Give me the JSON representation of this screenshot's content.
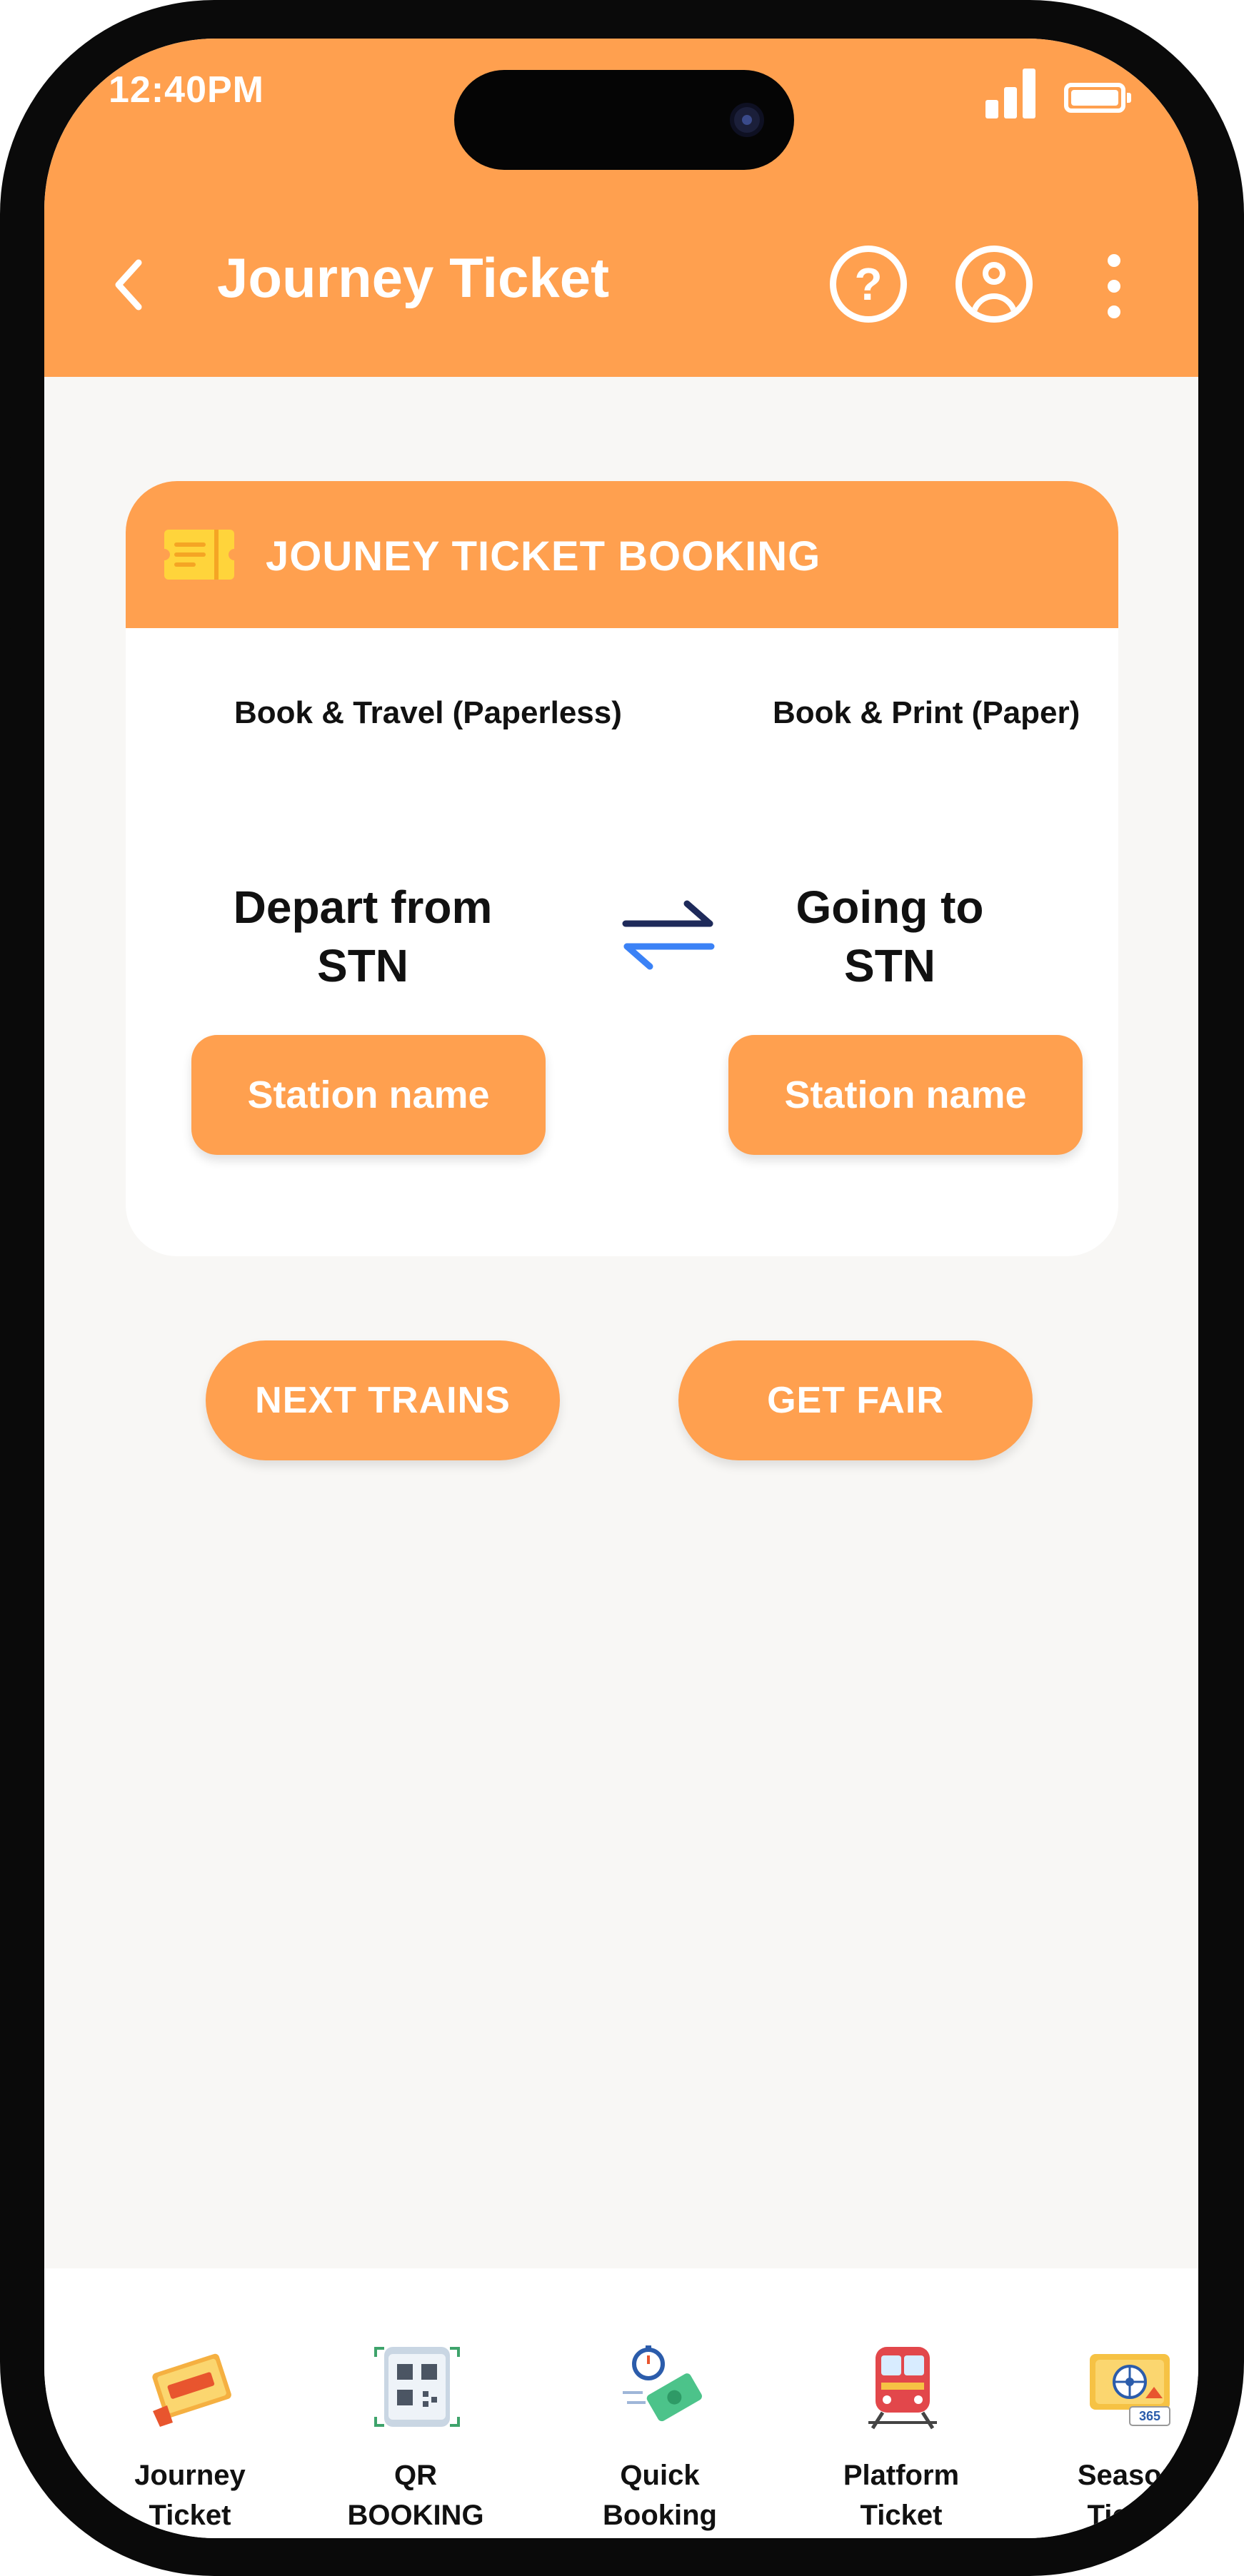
{
  "status_bar": {
    "time": "12:40PM"
  },
  "header": {
    "title": "Journey Ticket",
    "help_symbol": "?"
  },
  "card": {
    "title": "JOUNEY TICKET BOOKING",
    "tabs": [
      {
        "label": "Book & Travel (Paperless)"
      },
      {
        "label": "Book & Print (Paper)"
      }
    ],
    "from": {
      "line1": "Depart from",
      "line2": "STN",
      "button": "Station name"
    },
    "to": {
      "line1": "Going to",
      "line2": "STN",
      "button": "Station name"
    }
  },
  "actions": {
    "next_trains": "NEXT TRAINS",
    "get_fare": "GET FAIR"
  },
  "bottom_nav": [
    {
      "label": "Journey\nTicket",
      "icon": "journey-ticket-icon"
    },
    {
      "label": "QR\nBOOKING",
      "icon": "qr-code-icon"
    },
    {
      "label": "Quick\nBooking",
      "icon": "quick-booking-icon"
    },
    {
      "label": "Platform\nTicket",
      "icon": "train-icon"
    },
    {
      "label": "Season\nTicket",
      "icon": "season-ticket-icon"
    }
  ],
  "colors": {
    "accent": "#ffa04f",
    "background": "#f8f7f5",
    "swap_top": "#1e2a5a",
    "swap_bottom": "#3b82f6"
  }
}
